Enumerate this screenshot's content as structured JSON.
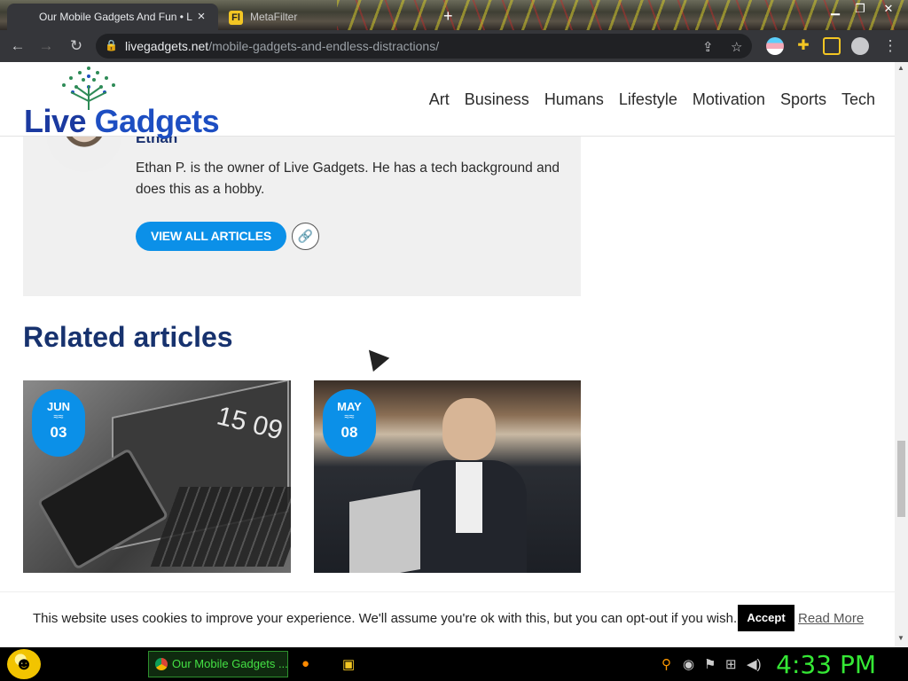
{
  "browser": {
    "tabs": [
      {
        "label": "Our Mobile Gadgets And Fun • L",
        "active": true
      },
      {
        "label": "MetaFilter",
        "active": false,
        "favicon_letter": "Fl"
      }
    ],
    "url_host": "livegadgets.net",
    "url_path": "/mobile-gadgets-and-endless-distractions/"
  },
  "site": {
    "logo_text_a": "Live",
    "logo_text_b": "Gadgets",
    "menu": [
      "Art",
      "Business",
      "Humans",
      "Lifestyle",
      "Motivation",
      "Sports",
      "Tech"
    ]
  },
  "author": {
    "name": "Ethan",
    "bio": "Ethan P. is the owner of Live Gadgets. He has a tech background and does this as a hobby.",
    "view_all_label": "VIEW ALL ARTICLES"
  },
  "related": {
    "title": "Related articles",
    "cards": [
      {
        "month": "JUN",
        "day": "03",
        "image_text": "15 09"
      },
      {
        "month": "MAY",
        "day": "08"
      }
    ]
  },
  "cookie": {
    "text": "This website uses cookies to improve your experience. We'll assume you're ok with this, but you can opt-out if you wish.",
    "accept_label": "Accept",
    "read_more_label": "Read More"
  },
  "taskbar": {
    "task_label": "Our Mobile Gadgets ...",
    "clock": "4:33 PM"
  },
  "colors": {
    "accent_blue": "#0b90e8",
    "heading_navy": "#17326e",
    "clock_green": "#35e835"
  }
}
